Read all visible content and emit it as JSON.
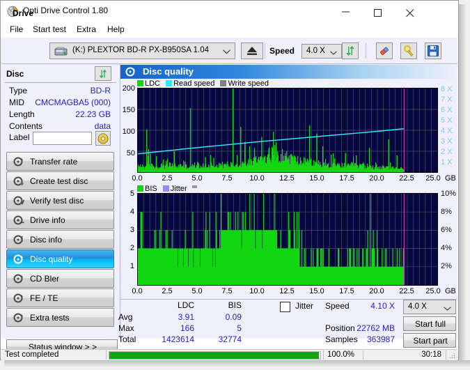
{
  "window": {
    "title": "Opti Drive Control 1.80",
    "icon": "disc-icon",
    "minimize": "minimize-icon",
    "maximize": "maximize-icon",
    "close": "close-icon"
  },
  "menu": {
    "items": [
      {
        "label": "File"
      },
      {
        "label": "Start test"
      },
      {
        "label": "Extra"
      },
      {
        "label": "Help"
      }
    ]
  },
  "drivebar": {
    "drive_label": "Drive",
    "drive_value": "(K:)  PLEXTOR BD-R  PX-B950SA 1.04",
    "eject_icon": "eject-icon",
    "speed_label": "Speed",
    "speed_value": "4.0 X",
    "refresh_icon": "refresh-icon",
    "erase_icon": "eraser-icon",
    "settings_icon": "settings-icon",
    "save_icon": "save-icon"
  },
  "disc": {
    "title": "Disc",
    "refresh_icon": "refresh-icon",
    "rows": [
      {
        "key": "Type",
        "value": "BD-R"
      },
      {
        "key": "MID",
        "value": "CMCMAGBA5 (000)"
      },
      {
        "key": "Length",
        "value": "22.23 GB"
      },
      {
        "key": "Contents",
        "value": "data"
      }
    ],
    "label_key": "Label",
    "label_value": "",
    "label_placeholder": "",
    "label_button_icon": "cd-icon"
  },
  "nav": {
    "items": [
      {
        "label": "Transfer rate",
        "icon": "disc-transfer-icon",
        "selected": false
      },
      {
        "label": "Create test disc",
        "icon": "disc-create-icon",
        "selected": false
      },
      {
        "label": "Verify test disc",
        "icon": "disc-verify-icon",
        "selected": false
      },
      {
        "label": "Drive info",
        "icon": "disc-drive-icon",
        "selected": false
      },
      {
        "label": "Disc info",
        "icon": "disc-info-icon",
        "selected": false
      },
      {
        "label": "Disc quality",
        "icon": "disc-quality-icon",
        "selected": true
      },
      {
        "label": "CD Bler",
        "icon": "disc-bler-icon",
        "selected": false
      },
      {
        "label": "FE / TE",
        "icon": "disc-fete-icon",
        "selected": false
      },
      {
        "label": "Extra tests",
        "icon": "disc-extra-icon",
        "selected": false
      }
    ],
    "status_window": "Status window > >"
  },
  "panel": {
    "title": "Disc quality",
    "icon": "disc-quality-icon"
  },
  "stats": {
    "col_ldc": "LDC",
    "col_bis": "BIS",
    "rows": [
      {
        "name": "Avg",
        "ldc": "3.91",
        "bis": "0.09"
      },
      {
        "name": "Max",
        "ldc": "166",
        "bis": "5"
      },
      {
        "name": "Total",
        "ldc": "1423614",
        "bis": "32774"
      }
    ],
    "jitter_label": "Jitter",
    "jitter_checked": false,
    "speed_label": "Speed",
    "speed_value": "4.10 X",
    "position_label": "Position",
    "position_value": "22762 MB",
    "samples_label": "Samples",
    "samples_value": "363987",
    "speed_select": "4.0 X",
    "start_full": "Start full",
    "start_part": "Start part"
  },
  "statusbar": {
    "message": "Test completed",
    "percent": "100.0%",
    "percent_value": 100,
    "elapsed": "30:18"
  },
  "colors": {
    "plot_bg": "#060640",
    "ldc_green": "#13d613",
    "read_speed_cyan": "#33e6ff",
    "write_speed_gray": "#808080",
    "bis_green": "#13d613",
    "jitter_lilac": "#8f8fe8",
    "grid": "#50505a",
    "marker_magenta": "#cc33cc",
    "accent_blue": "#2222cc",
    "progress_green": "#13a313",
    "selection_blue": "#1f8fd8"
  },
  "chart_data": [
    {
      "type": "area",
      "id": "quality-chart",
      "title": "Disc quality",
      "legend": [
        {
          "label": "LDC",
          "color": "#13d613"
        },
        {
          "label": "Read speed",
          "color": "#33e6ff"
        },
        {
          "label": "Write speed",
          "color": "#808080"
        }
      ],
      "legend_position": "top-left",
      "xlabel": "GB",
      "x_ticks": [
        "0.0",
        "2.5",
        "5.0",
        "7.5",
        "10.0",
        "12.5",
        "15.0",
        "17.5",
        "20.0",
        "22.5",
        "25.0"
      ],
      "xlim": [
        0,
        25
      ],
      "ylabel_left": "LDC",
      "y_ticks_left": [
        "50",
        "100",
        "150",
        "200"
      ],
      "ylim_left": [
        0,
        200
      ],
      "ylabel_right": "Speed",
      "y_ticks_right": [
        "1 X",
        "2 X",
        "3 X",
        "4 X",
        "5 X",
        "6 X",
        "7 X",
        "8 X"
      ],
      "ylim_right": [
        0,
        8
      ],
      "grid": true,
      "data_end_gb": 22.23,
      "series": [
        {
          "name": "LDC",
          "color": "#13d613",
          "note": "dense error-count trace, baseline ~10-25, rising bump near 9-11 GB",
          "baseline": [
            12,
            14,
            13,
            15,
            14,
            16,
            13,
            12,
            15,
            14,
            13,
            16,
            15,
            14,
            13,
            15,
            16,
            14,
            13,
            15,
            14,
            16,
            17,
            15,
            14,
            16,
            15,
            17,
            16,
            15,
            18,
            17,
            16,
            18,
            17,
            19,
            18,
            20,
            19,
            21,
            20,
            22,
            24,
            26,
            28,
            30,
            33,
            36,
            38,
            40,
            42,
            44,
            42,
            40,
            38,
            36,
            34,
            32,
            30,
            28,
            26,
            25,
            24,
            23,
            22,
            21,
            20,
            19,
            18,
            18,
            17,
            17,
            16,
            16,
            15,
            15,
            16,
            15,
            14,
            15,
            16,
            15,
            14,
            15,
            14,
            13,
            14,
            13,
            12,
            12,
            11,
            11,
            10,
            10,
            10,
            9,
            9,
            9,
            8,
            8
          ],
          "spikes": [
            {
              "x": 0.7,
              "y": 102
            },
            {
              "x": 0.85,
              "y": 55
            },
            {
              "x": 1.0,
              "y": 44
            },
            {
              "x": 1.5,
              "y": 38
            },
            {
              "x": 2.1,
              "y": 30
            },
            {
              "x": 3.0,
              "y": 50
            },
            {
              "x": 4.35,
              "y": 153
            },
            {
              "x": 5.6,
              "y": 36
            },
            {
              "x": 6.3,
              "y": 34
            },
            {
              "x": 7.9,
              "y": 200
            },
            {
              "x": 8.55,
              "y": 108
            },
            {
              "x": 8.9,
              "y": 72
            },
            {
              "x": 9.3,
              "y": 62
            },
            {
              "x": 9.7,
              "y": 58
            },
            {
              "x": 10.3,
              "y": 84
            },
            {
              "x": 10.9,
              "y": 57
            },
            {
              "x": 11.5,
              "y": 52
            },
            {
              "x": 12.6,
              "y": 40
            },
            {
              "x": 14.3,
              "y": 112
            },
            {
              "x": 14.9,
              "y": 92
            },
            {
              "x": 15.4,
              "y": 62
            },
            {
              "x": 16.1,
              "y": 42
            },
            {
              "x": 17.3,
              "y": 46
            },
            {
              "x": 18.2,
              "y": 40
            },
            {
              "x": 19.3,
              "y": 58
            },
            {
              "x": 20.9,
              "y": 78
            },
            {
              "x": 21.6,
              "y": 40
            }
          ],
          "max": 166
        },
        {
          "name": "Read speed",
          "color": "#33e6ff",
          "note": "CAV ramp from about 1.75X at 0 GB to 4.15X at 22.2 GB",
          "x": [
            0,
            2.5,
            5.0,
            7.5,
            10.0,
            12.5,
            15.0,
            17.5,
            20.0,
            22.2
          ],
          "y": [
            1.75,
            2.05,
            2.35,
            2.62,
            2.9,
            3.15,
            3.4,
            3.65,
            3.9,
            4.15
          ]
        },
        {
          "name": "Write speed",
          "color": "#808080",
          "x": [],
          "y": []
        }
      ],
      "markers": [
        {
          "x": 22.23,
          "color": "#cc33cc"
        }
      ]
    },
    {
      "type": "bar",
      "id": "bis-chart",
      "legend": [
        {
          "label": "BIS",
          "color": "#13d613"
        },
        {
          "label": "Jitter",
          "color": "#8f8fe8"
        }
      ],
      "legend_position": "top-left",
      "xlabel": "GB",
      "x_ticks": [
        "0.0",
        "2.5",
        "5.0",
        "7.5",
        "10.0",
        "12.5",
        "15.0",
        "17.5",
        "20.0",
        "22.5",
        "25.0"
      ],
      "xlim": [
        0,
        25
      ],
      "ylabel_left": "BIS",
      "y_ticks_left": [
        "1",
        "2",
        "3",
        "4",
        "5"
      ],
      "ylim_left": [
        0,
        5
      ],
      "ylabel_right": "Jitter",
      "y_ticks_right": [
        "2%",
        "4%",
        "6%",
        "8%",
        "10%"
      ],
      "ylim_right": [
        0,
        10
      ],
      "grid": true,
      "data_end_gb": 22.23,
      "series": [
        {
          "name": "BIS",
          "color": "#13d613",
          "note": "per-sample BIS counts; mostly 2 from 0-13.5 GB, 3 from 7-11.5 GB, 1 from 13.5-22.2 GB with frequent 2-3 spikes",
          "max": 5
        },
        {
          "name": "Jitter",
          "color": "#8f8fe8",
          "note": "jitter not measured, no data drawn",
          "values": []
        }
      ],
      "markers": [
        {
          "x": 22.23,
          "color": "#cc33cc"
        }
      ]
    }
  ]
}
